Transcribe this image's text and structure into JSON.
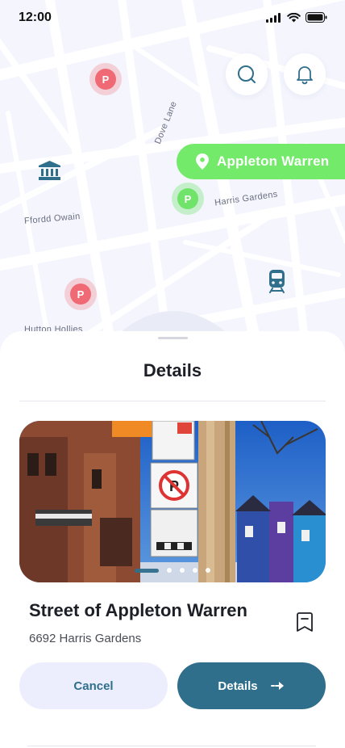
{
  "status_bar": {
    "time": "12:00"
  },
  "map": {
    "labels": {
      "dove_lane": "Dove Lane",
      "harris_gardens": "Harris Gardens",
      "ffordd_owain": "Ffordd Owain",
      "hutton_hollies": "Hutton Hollies"
    },
    "pin_letter": "P",
    "selected_location": "Appleton Warren",
    "icons": [
      "search-icon",
      "bell-icon",
      "location-pin-icon",
      "museum-icon",
      "train-icon"
    ]
  },
  "sheet": {
    "title": "Details",
    "carousel": {
      "total_slides": 5,
      "active_slide": 1
    },
    "street_title": "Street of Appleton Warren",
    "street_address": "6692 Harris Gardens",
    "buttons": {
      "cancel_label": "Cancel",
      "details_label": "Details"
    }
  },
  "colors": {
    "primary": "#2f6f8c",
    "accent_green": "#73ea6a",
    "pin_red": "#ef6a74",
    "secondary_button_bg": "#eceefd"
  }
}
